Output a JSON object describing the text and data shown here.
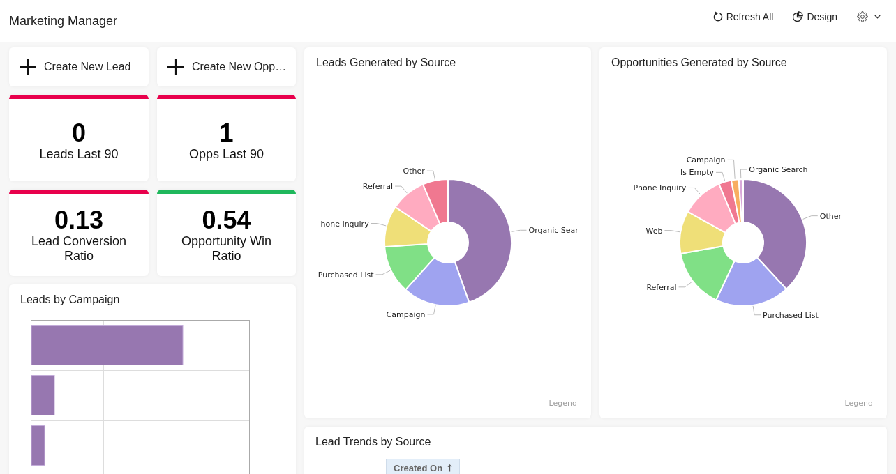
{
  "header": {
    "title": "Marketing Manager",
    "actions": [
      {
        "kind": "refresh",
        "label": "Refresh All"
      },
      {
        "kind": "design",
        "label": "Design"
      },
      {
        "kind": "settings"
      }
    ]
  },
  "quick_actions": [
    {
      "label": "Create New Lead"
    },
    {
      "label": "Create New Opp…"
    }
  ],
  "kpis": [
    {
      "value": "0",
      "label": "Leads Last 90",
      "color": "#e8004c"
    },
    {
      "value": "1",
      "label": "Opps Last 90",
      "color": "#e8004c"
    },
    {
      "value": "0.13",
      "label": "Lead Conversion Ratio",
      "color": "#e8004c"
    },
    {
      "value": "0.54",
      "label": "Opportunity Win Ratio",
      "color": "#1fb85c"
    }
  ],
  "leads_by_campaign": {
    "title": "Leads by Campaign"
  },
  "leads_by_source": {
    "title": "Leads Generated by Source",
    "legend_toggle": "Legend",
    "chart_data": {
      "type": "donut",
      "categories": [
        "Organic Sear",
        "Campaign",
        "Purchased List",
        "hone Inquiry",
        "Referral",
        "Other"
      ],
      "values": [
        44.2,
        16.9,
        12.2,
        10.4,
        9.0,
        6.4
      ]
    }
  },
  "opportunities_by_source": {
    "title": "Opportunities Generated by Source",
    "legend_toggle": "Legend",
    "chart_data": {
      "type": "donut",
      "categories": [
        "Other",
        "Purchased List",
        "Referral",
        "Web",
        "Phone Inquiry",
        "Is Empty",
        "Campaign",
        "Organic Search"
      ],
      "values": [
        38.1,
        18.9,
        15.2,
        10.9,
        10.7,
        3.2,
        1.9,
        1.1
      ]
    }
  },
  "lead_trends": {
    "title": "Lead Trends by Source",
    "columns": [
      {
        "label": "Created On",
        "sort_ascending": true
      }
    ]
  }
}
